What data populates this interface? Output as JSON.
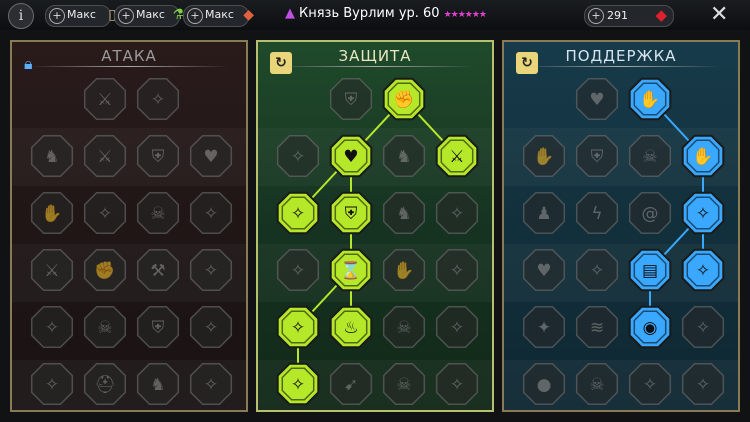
{
  "topbar": {
    "info_label": "i",
    "resources": [
      {
        "label": "Макс",
        "icon": "scroll-icon"
      },
      {
        "label": "Макс",
        "icon": "potion-icon"
      },
      {
        "label": "Макс",
        "icon": "meat-icon"
      }
    ],
    "hero_name": "Князь Вурлим ур. 60",
    "hero_stars": "★★★★★★",
    "gems": "291",
    "close_label": "✕"
  },
  "panels": [
    {
      "title": "АТАКА",
      "state": "locked"
    },
    {
      "title": "ЗАЩИТА",
      "state": "active"
    },
    {
      "title": "ПОДДЕРЖКА",
      "state": "active"
    }
  ],
  "colors": {
    "attack": "#6b6b6b",
    "defense": "#b6e82a",
    "support": "#3aa8ff"
  },
  "trees": [
    {
      "name": "attack",
      "cols": 4,
      "nodes": [
        {
          "row": 0,
          "col": 1,
          "icon": "crossed-swords-icon",
          "active": false
        },
        {
          "row": 0,
          "col": 2,
          "icon": "claw-slash-icon",
          "active": false
        },
        {
          "row": 1,
          "col": 0,
          "icon": "beast-head-icon",
          "active": false
        },
        {
          "row": 1,
          "col": 1,
          "icon": "blade-fan-icon",
          "active": false
        },
        {
          "row": 1,
          "col": 2,
          "icon": "shield-strike-icon",
          "active": false
        },
        {
          "row": 1,
          "col": 3,
          "icon": "demon-heart-icon",
          "active": false
        },
        {
          "row": 2,
          "col": 0,
          "icon": "dagger-hand-icon",
          "active": false
        },
        {
          "row": 2,
          "col": 1,
          "icon": "fangs-icon",
          "active": false
        },
        {
          "row": 2,
          "col": 2,
          "icon": "skull-orb-icon",
          "active": false
        },
        {
          "row": 2,
          "col": 3,
          "icon": "sword-hit-icon",
          "active": false
        },
        {
          "row": 3,
          "col": 0,
          "icon": "blade-up-icon",
          "active": false
        },
        {
          "row": 3,
          "col": 1,
          "icon": "fist-icon",
          "active": false
        },
        {
          "row": 3,
          "col": 2,
          "icon": "axe-icon",
          "active": false
        },
        {
          "row": 3,
          "col": 3,
          "icon": "scatter-icon",
          "active": false
        },
        {
          "row": 4,
          "col": 0,
          "icon": "cloak-icon",
          "active": false
        },
        {
          "row": 4,
          "col": 1,
          "icon": "skull-icon",
          "active": false
        },
        {
          "row": 4,
          "col": 2,
          "icon": "sword-shield-icon",
          "active": false
        },
        {
          "row": 4,
          "col": 3,
          "icon": "warrior-icon",
          "active": false
        },
        {
          "row": 5,
          "col": 0,
          "icon": "spark-icon",
          "active": false
        },
        {
          "row": 5,
          "col": 1,
          "icon": "helmet-icon",
          "active": false
        },
        {
          "row": 5,
          "col": 2,
          "icon": "winged-beast-icon",
          "active": false
        },
        {
          "row": 5,
          "col": 3,
          "icon": "champion-icon",
          "active": false
        }
      ],
      "links": []
    },
    {
      "name": "defense",
      "cols": 4,
      "nodes": [
        {
          "row": 0,
          "col": 1,
          "icon": "brick-shield-icon",
          "active": false
        },
        {
          "row": 0,
          "col": 2,
          "icon": "raised-fist-icon",
          "active": true
        },
        {
          "row": 1,
          "col": 0,
          "icon": "hooded-icon",
          "active": false
        },
        {
          "row": 1,
          "col": 1,
          "icon": "heart-hand-icon",
          "active": true
        },
        {
          "row": 1,
          "col": 2,
          "icon": "armored-beast-icon",
          "active": false
        },
        {
          "row": 1,
          "col": 3,
          "icon": "crossed-blades-icon",
          "active": true
        },
        {
          "row": 2,
          "col": 0,
          "icon": "guard-stance-icon",
          "active": true
        },
        {
          "row": 2,
          "col": 1,
          "icon": "knight-shield-icon",
          "active": true
        },
        {
          "row": 2,
          "col": 2,
          "icon": "beast-paw-icon",
          "active": false
        },
        {
          "row": 2,
          "col": 3,
          "icon": "bearded-icon",
          "active": false
        },
        {
          "row": 3,
          "col": 0,
          "icon": "pillar-icon",
          "active": false
        },
        {
          "row": 3,
          "col": 1,
          "icon": "hourglass-icon",
          "active": true
        },
        {
          "row": 3,
          "col": 2,
          "icon": "open-hand-icon",
          "active": false
        },
        {
          "row": 3,
          "col": 3,
          "icon": "horned-icon",
          "active": false
        },
        {
          "row": 4,
          "col": 0,
          "icon": "dash-icon",
          "active": true
        },
        {
          "row": 4,
          "col": 1,
          "icon": "triple-flame-icon",
          "active": true
        },
        {
          "row": 4,
          "col": 2,
          "icon": "skull-icon",
          "active": false
        },
        {
          "row": 4,
          "col": 3,
          "icon": "slash-icon",
          "active": false
        },
        {
          "row": 5,
          "col": 0,
          "icon": "armored-lord-icon",
          "active": true
        },
        {
          "row": 5,
          "col": 1,
          "icon": "arrows-icon",
          "active": false
        },
        {
          "row": 5,
          "col": 2,
          "icon": "demon-skull-icon",
          "active": false
        },
        {
          "row": 5,
          "col": 3,
          "icon": "sorcerer-icon",
          "active": false
        }
      ],
      "links": [
        [
          0,
          2,
          1,
          1
        ],
        [
          0,
          2,
          1,
          3
        ],
        [
          1,
          1,
          2,
          0
        ],
        [
          1,
          1,
          2,
          1
        ],
        [
          2,
          1,
          3,
          1
        ],
        [
          3,
          1,
          4,
          0
        ],
        [
          3,
          1,
          4,
          1
        ],
        [
          4,
          0,
          5,
          0
        ]
      ]
    },
    {
      "name": "support",
      "cols": 4,
      "nodes": [
        {
          "row": 0,
          "col": 1,
          "icon": "heart-icon",
          "active": false
        },
        {
          "row": 0,
          "col": 2,
          "icon": "swirl-hand-icon",
          "active": true
        },
        {
          "row": 1,
          "col": 0,
          "icon": "praying-hands-icon",
          "active": false
        },
        {
          "row": 1,
          "col": 1,
          "icon": "feather-shield-icon",
          "active": false
        },
        {
          "row": 1,
          "col": 2,
          "icon": "skull-icon",
          "active": false
        },
        {
          "row": 1,
          "col": 3,
          "icon": "flowing-hand-icon",
          "active": true
        },
        {
          "row": 2,
          "col": 0,
          "icon": "figures-icon",
          "active": false
        },
        {
          "row": 2,
          "col": 1,
          "icon": "lightning-icon",
          "active": false
        },
        {
          "row": 2,
          "col": 2,
          "icon": "spiral-icon",
          "active": false
        },
        {
          "row": 2,
          "col": 3,
          "icon": "silhouette-icon",
          "active": true
        },
        {
          "row": 3,
          "col": 0,
          "icon": "heart-hands-icon",
          "active": false
        },
        {
          "row": 3,
          "col": 1,
          "icon": "comet-icon",
          "active": false
        },
        {
          "row": 3,
          "col": 2,
          "icon": "book-icon",
          "active": true
        },
        {
          "row": 3,
          "col": 3,
          "icon": "tentacle-face-icon",
          "active": true
        },
        {
          "row": 4,
          "col": 0,
          "icon": "compass-star-icon",
          "active": false
        },
        {
          "row": 4,
          "col": 1,
          "icon": "wind-icon",
          "active": false
        },
        {
          "row": 4,
          "col": 2,
          "icon": "eye-icon",
          "active": true
        },
        {
          "row": 4,
          "col": 3,
          "icon": "runner-icon",
          "active": false
        },
        {
          "row": 5,
          "col": 0,
          "icon": "orb-icon",
          "active": false
        },
        {
          "row": 5,
          "col": 1,
          "icon": "skull-icon",
          "active": false
        },
        {
          "row": 5,
          "col": 2,
          "icon": "robed-icon",
          "active": false
        },
        {
          "row": 5,
          "col": 3,
          "icon": "eagle-icon",
          "active": false
        }
      ],
      "links": [
        [
          0,
          2,
          1,
          3
        ],
        [
          1,
          3,
          2,
          3
        ],
        [
          2,
          3,
          3,
          2
        ],
        [
          2,
          3,
          3,
          3
        ],
        [
          3,
          2,
          4,
          2
        ]
      ]
    }
  ]
}
